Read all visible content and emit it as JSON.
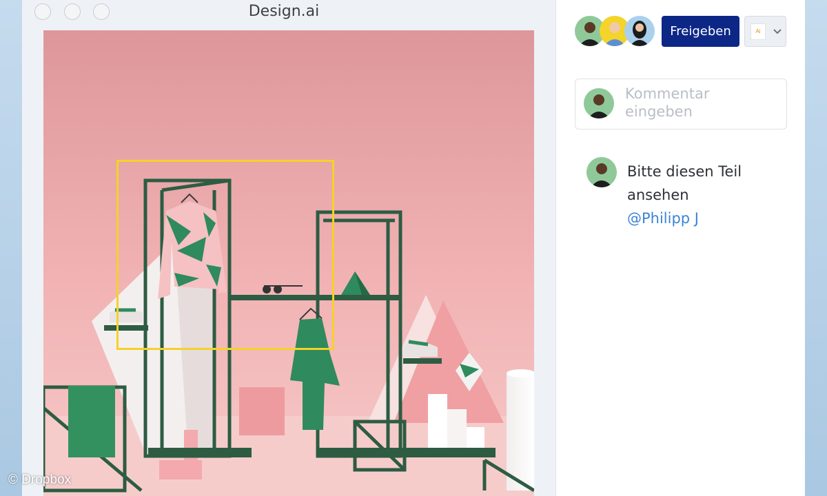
{
  "window": {
    "title": "Design.ai",
    "traffic_lights": [
      "close",
      "minimize",
      "zoom"
    ]
  },
  "collaborators": [
    {
      "icon": "avatar-man-green"
    },
    {
      "icon": "avatar-man-yellow"
    },
    {
      "icon": "avatar-woman-blue"
    }
  ],
  "toolbar": {
    "share_label": "Freigeben",
    "file_badge": "Ai",
    "file_icon": "illustrator-file-icon",
    "dropdown_icon": "chevron-down-icon"
  },
  "comment_input": {
    "placeholder": "Kommentar eingeben",
    "value": ""
  },
  "comment": {
    "text": "Bitte diesen Teil ansehen",
    "mention": "@Philipp J"
  },
  "canvas": {
    "selection_color": "#f4d22a"
  },
  "watermark": "© Dropbox",
  "colors": {
    "accent": "#0d2787",
    "mention": "#3b83d9",
    "background_pink": "#e3a1a4",
    "rack_green": "#2d5c43"
  }
}
